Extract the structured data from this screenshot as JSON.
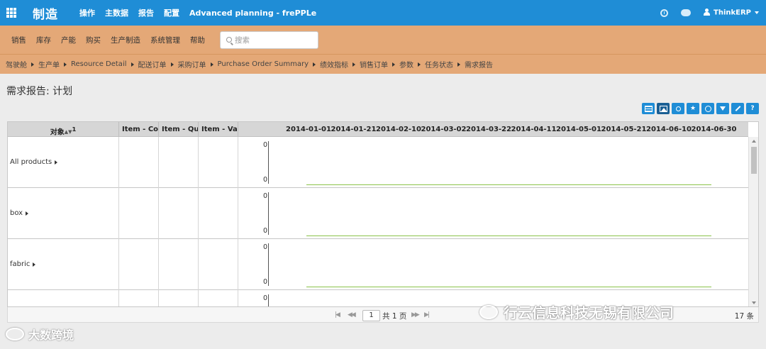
{
  "topbar": {
    "brand": "制造",
    "menu": [
      "操作",
      "主数据",
      "报告",
      "配置",
      "Advanced planning - frePPLe"
    ],
    "user": "ThinkERP"
  },
  "menubar": {
    "items": [
      "销售",
      "库存",
      "产能",
      "购买",
      "生产制造",
      "系统管理",
      "帮助"
    ],
    "search_placeholder": "搜索"
  },
  "breadcrumb": [
    "驾驶舱",
    "生产单",
    "Resource Detail",
    "配送订单",
    "采购订单",
    "Purchase Order Summary",
    "绩效指标",
    "销售订单",
    "参数",
    "任务状态",
    "需求报告"
  ],
  "page_title": "需求报告: 计划",
  "toolbar": [
    "table-view",
    "graph-view",
    "filter",
    "favorite",
    "time-buckets",
    "export",
    "configure",
    "help"
  ],
  "grid": {
    "columns": {
      "object": "对象",
      "sort_rank": "1",
      "item_cost": "Item - Cost",
      "item_quantity": "Item - Quantity",
      "item_value": "Item - Value"
    },
    "dates": [
      "2014-01-01",
      "2014-01-21",
      "2014-02-10",
      "2014-03-02",
      "2014-03-22",
      "2014-04-11",
      "2014-05-01",
      "2014-05-21",
      "2014-06-10",
      "2014-06-30"
    ],
    "rows": [
      {
        "label": "All products",
        "ymax": "0",
        "ymin": "0"
      },
      {
        "label": "box",
        "ymax": "0",
        "ymin": "0"
      },
      {
        "label": "fabric",
        "ymax": "0",
        "ymin": "0"
      },
      {
        "label": "",
        "ymax": "0",
        "ymin": ""
      }
    ]
  },
  "pager": {
    "current_page": "1",
    "total_pages_text": "共 1 页",
    "record_count": "17 条"
  },
  "watermarks": {
    "company": "行云信息科技无锡有限公司",
    "brand": "大数跨境"
  },
  "colors": {
    "topbar": "#1f8dd6",
    "menubar": "#e4a877",
    "chart_line": "#8bc34a"
  }
}
